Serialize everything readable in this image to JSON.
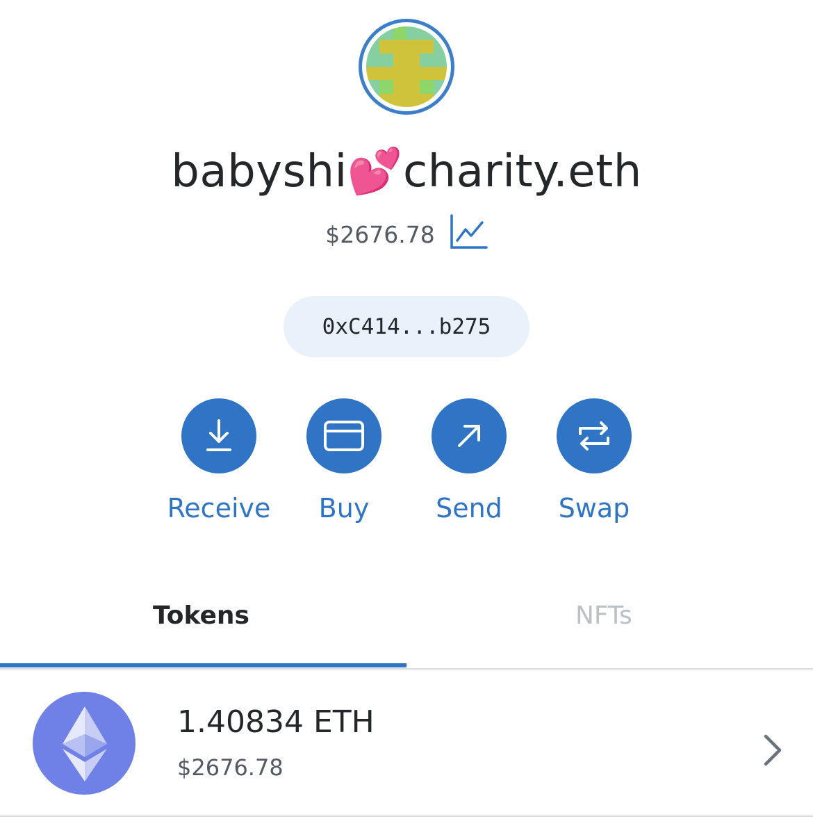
{
  "account": {
    "name": "babyshi💕charity.eth",
    "balance": "$2676.78",
    "address": "0xC414...b275"
  },
  "actions": [
    {
      "label": "Receive",
      "icon": "receive-arrow-icon"
    },
    {
      "label": "Buy",
      "icon": "card-icon"
    },
    {
      "label": "Send",
      "icon": "send-arrow-icon"
    },
    {
      "label": "Swap",
      "icon": "swap-icon"
    }
  ],
  "tabs": {
    "tokens": "Tokens",
    "nfts": "NFTs",
    "active": "Tokens"
  },
  "tokens": [
    {
      "amount": "1.40834 ETH",
      "fiat": "$2676.78",
      "icon": "eth-icon"
    }
  ],
  "colors": {
    "accent": "#2f74c5",
    "pill": "#e9f1fa",
    "eth": "#6f80e6",
    "text": "#24272a",
    "muted": "#535a61"
  }
}
